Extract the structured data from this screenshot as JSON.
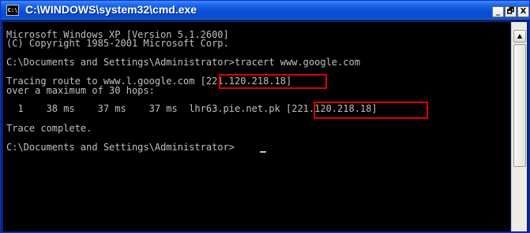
{
  "window": {
    "title": "C:\\WINDOWS\\system32\\cmd.exe",
    "icon_label": "C:\\",
    "icon": "cmd-icon",
    "controls": {
      "minimize": "_",
      "maximize": "🗗",
      "close": "X"
    }
  },
  "console": {
    "lines": [
      "Microsoft Windows XP [Version 5.1.2600]",
      "(C) Copyright 1985-2001 Microsoft Corp.",
      "",
      "C:\\Documents and Settings\\Administrator>tracert www.google.com",
      "",
      "Tracing route to www.l.google.com [221.120.218.18]",
      "over a maximum of 30 hops:",
      "",
      "  1    38 ms    37 ms    37 ms  lhr63.pie.net.pk [221.120.218.18]",
      "",
      "Trace complete.",
      "",
      "C:\\Documents and Settings\\Administrator>"
    ]
  },
  "colors": {
    "highlight": "#E00000",
    "console_text": "#C0C0C0",
    "console_bg": "#000000"
  },
  "scrollbar": {
    "up_arrow": "▲"
  }
}
